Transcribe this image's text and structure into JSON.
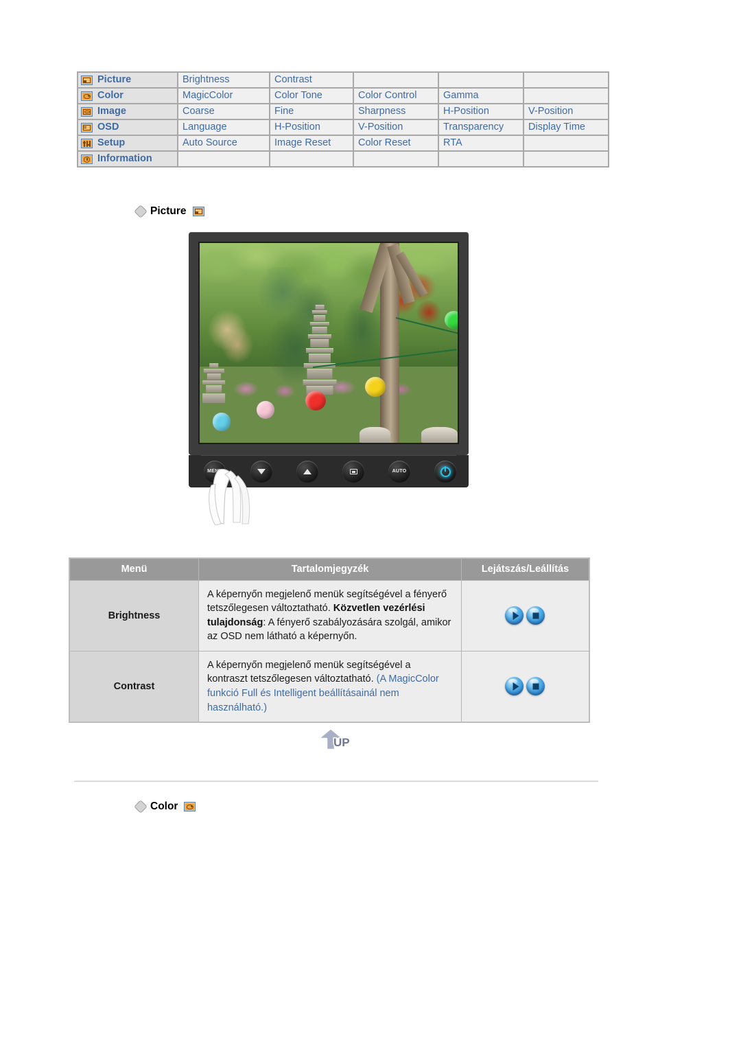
{
  "nav_table": {
    "rows": [
      {
        "icon": "picture-icon",
        "category": "Picture",
        "items": [
          "Brightness",
          "Contrast",
          "",
          "",
          ""
        ]
      },
      {
        "icon": "color-icon",
        "category": "Color",
        "items": [
          "MagicColor",
          "Color Tone",
          "Color Control",
          "Gamma",
          ""
        ]
      },
      {
        "icon": "image-icon",
        "category": "Image",
        "items": [
          "Coarse",
          "Fine",
          "Sharpness",
          "H-Position",
          "V-Position"
        ]
      },
      {
        "icon": "osd-icon",
        "category": "OSD",
        "items": [
          "Language",
          "H-Position",
          "V-Position",
          "Transparency",
          "Display Time"
        ]
      },
      {
        "icon": "setup-icon",
        "category": "Setup",
        "items": [
          "Auto Source",
          "Image Reset",
          "Color Reset",
          "RTA",
          ""
        ]
      },
      {
        "icon": "information-icon",
        "category": "Information",
        "items": [
          "",
          "",
          "",
          "",
          ""
        ]
      }
    ]
  },
  "sections": {
    "picture": {
      "label": "Picture",
      "icon": "picture-icon"
    },
    "color": {
      "label": "Color",
      "icon": "color-icon"
    }
  },
  "monitor": {
    "buttons": [
      {
        "name": "menu-button",
        "label": "MENU"
      },
      {
        "name": "down-button",
        "label": ""
      },
      {
        "name": "brightness-button",
        "label": ""
      },
      {
        "name": "source-button",
        "label": ""
      },
      {
        "name": "auto-button",
        "label": "AUTO"
      },
      {
        "name": "power-button",
        "label": ""
      }
    ]
  },
  "desc_table": {
    "headers": [
      "Menü",
      "Tartalomjegyzék",
      "Lejátszás/Leállítás"
    ],
    "rows": [
      {
        "menu": "Brightness",
        "line1": "A képernyőn megjelenő menük segítségével a fényerő tetszőlegesen változtatható.",
        "bold_lead": "Közvetlen vezérlési tulajdonság",
        "line2": ": A fényerő szabályozására szolgál, amikor az OSD nem látható a képernyőn.",
        "note": ""
      },
      {
        "menu": "Contrast",
        "line1": "A képernyőn megjelenő menük segítségével a kontraszt tetszőlegesen változtatható.",
        "bold_lead": "",
        "line2": "",
        "note_open": "(",
        "note": "A MagicColor funkció Full és Intelligent beállításainál nem használható.",
        "note_close": ")"
      }
    ]
  },
  "up_button": {
    "label": "UP"
  },
  "colors": {
    "link_blue": "#3f6ba3",
    "header_gray": "#999999",
    "menu_cell_gray": "#d6d6d6",
    "content_cell_gray": "#ededed",
    "icon_orange": "#f3a337",
    "power_cyan": "#23c6ef"
  }
}
